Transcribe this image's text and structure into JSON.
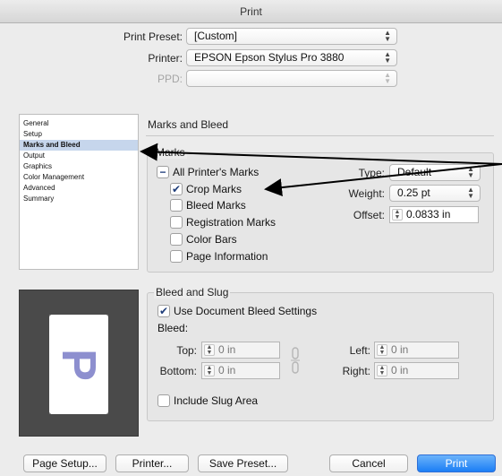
{
  "window": {
    "title": "Print"
  },
  "header": {
    "print_preset_label": "Print Preset:",
    "print_preset_value": "[Custom]",
    "printer_label": "Printer:",
    "printer_value": "EPSON Epson Stylus Pro 3880",
    "ppd_label": "PPD:",
    "ppd_value": ""
  },
  "sidebar": {
    "items": [
      {
        "label": "General",
        "selected": false
      },
      {
        "label": "Setup",
        "selected": false
      },
      {
        "label": "Marks and Bleed",
        "selected": true
      },
      {
        "label": "Output",
        "selected": false
      },
      {
        "label": "Graphics",
        "selected": false
      },
      {
        "label": "Color Management",
        "selected": false
      },
      {
        "label": "Advanced",
        "selected": false
      },
      {
        "label": "Summary",
        "selected": false
      }
    ]
  },
  "panel": {
    "title": "Marks and Bleed"
  },
  "marks": {
    "group_label": "Marks",
    "all_printers_marks": {
      "label": "All Printer's Marks",
      "state": "mixed"
    },
    "crop_marks": {
      "label": "Crop Marks",
      "checked": true
    },
    "bleed_marks": {
      "label": "Bleed Marks",
      "checked": false
    },
    "registration_marks": {
      "label": "Registration Marks",
      "checked": false
    },
    "color_bars": {
      "label": "Color Bars",
      "checked": false
    },
    "page_information": {
      "label": "Page Information",
      "checked": false
    },
    "type_label": "Type:",
    "type_value": "Default",
    "weight_label": "Weight:",
    "weight_value": "0.25 pt",
    "offset_label": "Offset:",
    "offset_value": "0.0833 in"
  },
  "bleed": {
    "group_label": "Bleed and Slug",
    "use_document": {
      "label": "Use Document Bleed Settings",
      "checked": true
    },
    "bleed_label": "Bleed:",
    "top_label": "Top:",
    "top_value": "0 in",
    "bottom_label": "Bottom:",
    "bottom_value": "0 in",
    "left_label": "Left:",
    "left_value": "0 in",
    "right_label": "Right:",
    "right_value": "0 in",
    "include_slug": {
      "label": "Include Slug Area",
      "checked": false
    }
  },
  "preview": {
    "glyph": "P"
  },
  "buttons": {
    "page_setup": "Page Setup...",
    "printer": "Printer...",
    "save_preset": "Save Preset...",
    "cancel": "Cancel",
    "print": "Print"
  },
  "icons": {
    "checkmark": "✔",
    "mixed": "−",
    "updown": "⇕",
    "chain": "chain-link-icon"
  },
  "colors": {
    "accent": "#1b7ef5",
    "selection": "#c6d6ec",
    "preview_bg": "#4a4a4a",
    "preview_glyph": "#8d8fcf"
  }
}
